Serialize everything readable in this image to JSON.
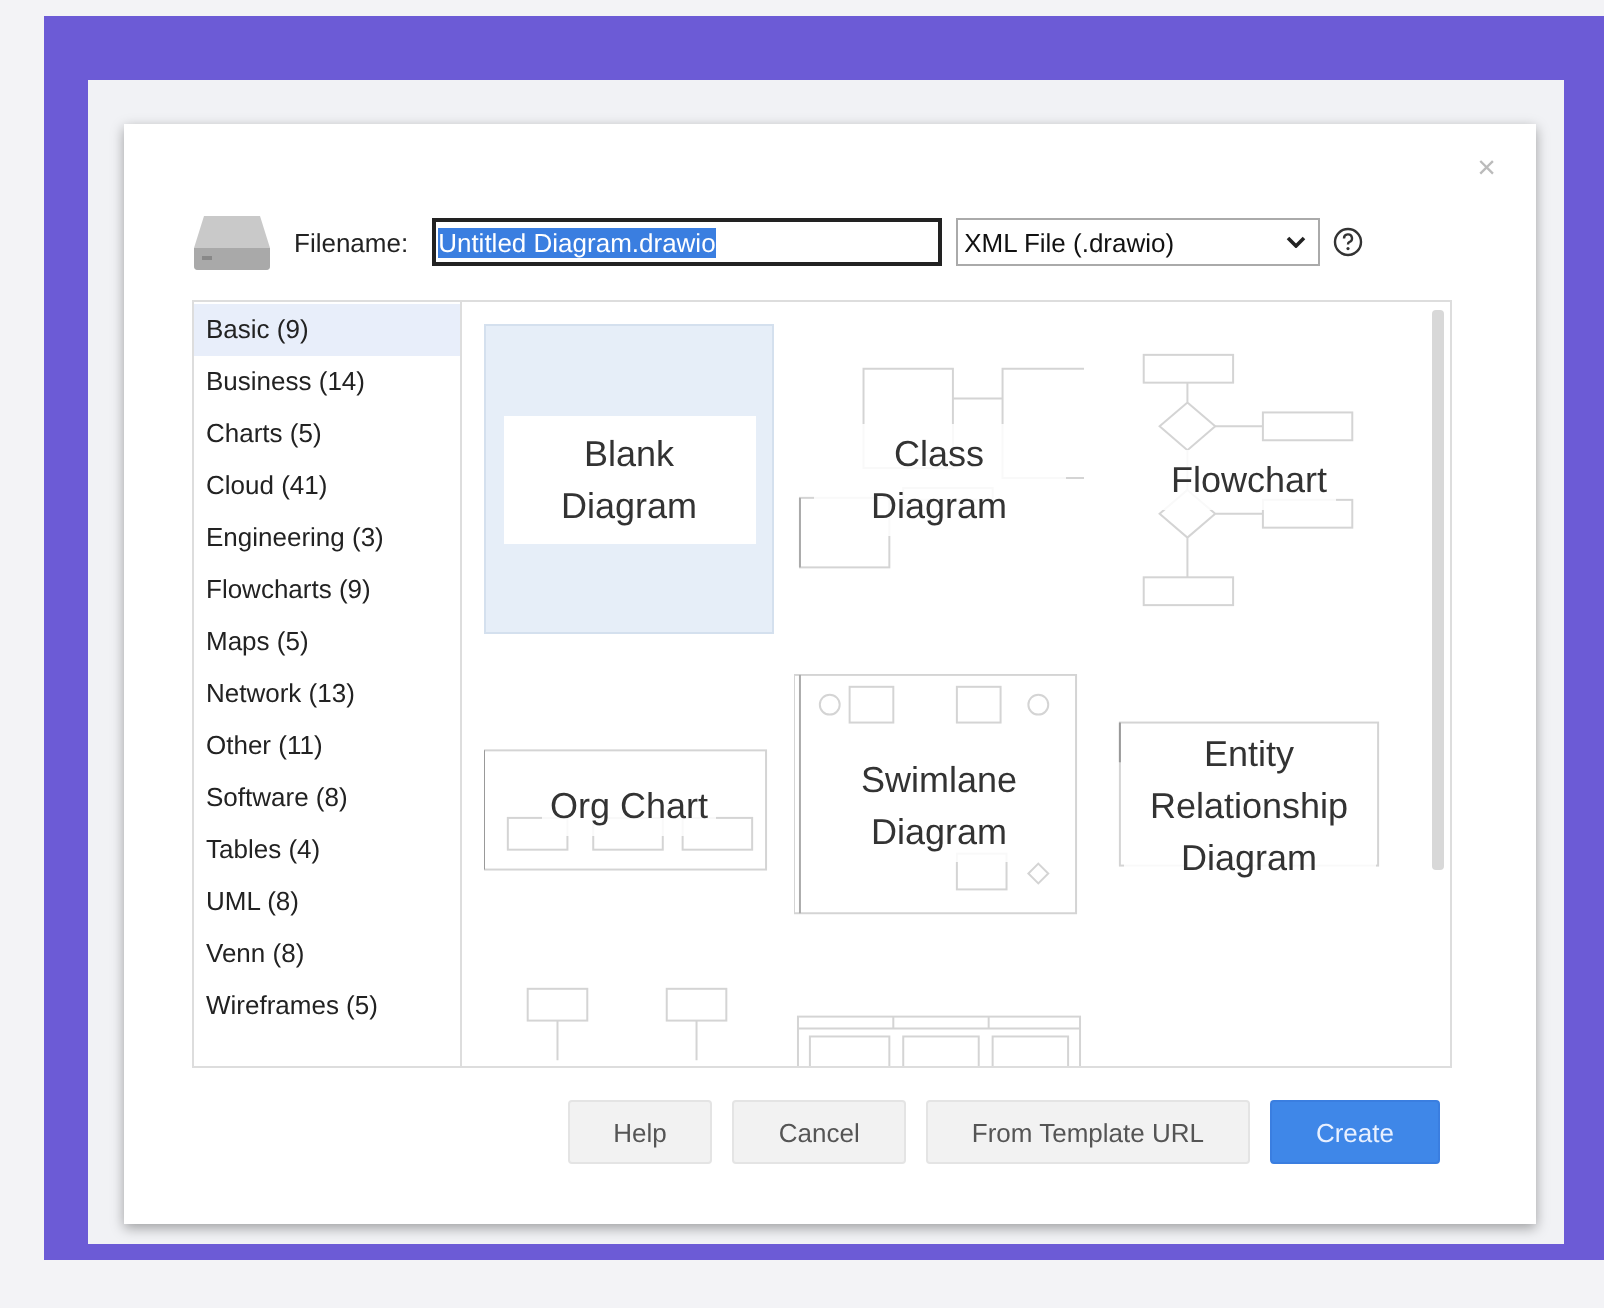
{
  "dialog": {
    "close": "×",
    "filename_label": "Filename:",
    "filename_value": "Untitled Diagram.drawio",
    "filename_selected": true,
    "format": "XML File (.drawio)"
  },
  "categories": [
    {
      "label": "Basic (9)",
      "selected": true
    },
    {
      "label": "Business (14)",
      "selected": false
    },
    {
      "label": "Charts (5)",
      "selected": false
    },
    {
      "label": "Cloud (41)",
      "selected": false
    },
    {
      "label": "Engineering (3)",
      "selected": false
    },
    {
      "label": "Flowcharts (9)",
      "selected": false
    },
    {
      "label": "Maps (5)",
      "selected": false
    },
    {
      "label": "Network (13)",
      "selected": false
    },
    {
      "label": "Other (11)",
      "selected": false
    },
    {
      "label": "Software (8)",
      "selected": false
    },
    {
      "label": "Tables (4)",
      "selected": false
    },
    {
      "label": "UML (8)",
      "selected": false
    },
    {
      "label": "Venn (8)",
      "selected": false
    },
    {
      "label": "Wireframes (5)",
      "selected": false
    }
  ],
  "templates": [
    {
      "kind": "blank",
      "title": "Blank Diagram",
      "selected": true
    },
    {
      "kind": "class",
      "title": "Class Diagram",
      "selected": false
    },
    {
      "kind": "flowchart",
      "title": "Flowchart",
      "selected": false
    },
    {
      "kind": "org",
      "title": "Org Chart",
      "selected": false
    },
    {
      "kind": "swimlane",
      "title": "Swimlane Diagram",
      "selected": false
    },
    {
      "kind": "er",
      "title": "Entity Relationship Diagram",
      "selected": false
    },
    {
      "kind": "tree",
      "selected": false
    },
    {
      "kind": "table",
      "selected": false
    }
  ],
  "buttons": [
    {
      "label": "Help",
      "primary": false
    },
    {
      "label": "Cancel",
      "primary": false
    },
    {
      "label": "From Template URL",
      "primary": false
    },
    {
      "label": "Create",
      "primary": true
    }
  ]
}
